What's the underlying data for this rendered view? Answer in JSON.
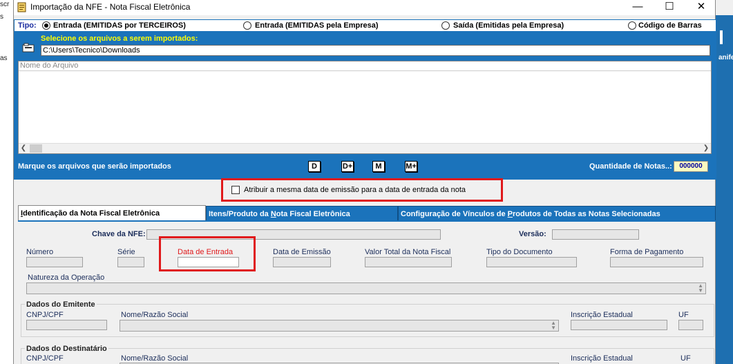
{
  "background": {
    "left_fragments": [
      "scr",
      "s",
      "as"
    ],
    "right_fragment": "anife"
  },
  "window": {
    "title": "Importação da NFE - Nota Fiscal Eletrônica",
    "minimize": "—",
    "maximize": "☐",
    "close": "✕"
  },
  "tipo": {
    "label": "Tipo:",
    "options": [
      {
        "label": "Entrada (EMITIDAS por TERCEIROS)",
        "selected": true
      },
      {
        "label": "Entrada (EMITIDAS pela Empresa)",
        "selected": false
      },
      {
        "label": "Saída (Emitidas pela Empresa)",
        "selected": false
      },
      {
        "label": "Código de Barras",
        "selected": false
      }
    ]
  },
  "files": {
    "select_label": "Selecione os arquivos a serem importados:",
    "path": "C:\\Users\\Tecnico\\Downloads",
    "column_header": "Nome do Arquivo",
    "rows": []
  },
  "marks": {
    "label": "Marque os arquivos que serão importados",
    "buttons": [
      "D",
      "D+",
      "M",
      "M+"
    ],
    "quantity_label": "Quantidade de Notas..:",
    "quantity_value": "000000"
  },
  "same_date": {
    "label": "Atribuir a mesma data de emissão para a data de entrada da nota",
    "checked": false
  },
  "tabs": [
    {
      "pre": "",
      "ul": "I",
      "post": "dentificação da Nota Fiscal Eletrônica",
      "active": true
    },
    {
      "pre": "Itens/Produto da ",
      "ul": "N",
      "post": "ota Fiscal Eletrônica",
      "active": false
    },
    {
      "pre": "Configuração de Vínculos de ",
      "ul": "P",
      "post": "rodutos de Todas as Notas Selecionadas",
      "active": false
    }
  ],
  "form": {
    "chave_label": "Chave da NFE:",
    "versao_label": "Versão:",
    "numero_label": "Número",
    "serie_label": "Série",
    "data_entrada_label": "Data de Entrada",
    "data_emissao_label": "Data de Emissão",
    "valor_total_label": "Valor Total da Nota Fiscal",
    "tipo_documento_label": "Tipo do Documento",
    "forma_pagamento_label": "Forma de Pagamento",
    "natureza_label": "Natureza da Operação"
  },
  "emitente": {
    "title": "Dados do Emitente",
    "cnpj_label": "CNPJ/CPF",
    "nome_label": "Nome/Razão Social",
    "ie_label": "Inscrição Estadual",
    "uf_label": "UF"
  },
  "destinatario": {
    "title": "Dados do Destinatário",
    "cnpj_label": "CNPJ/CPF",
    "nome_label": "Nome/Razão Social",
    "ie_label": "Inscrição Estadual",
    "uf_label": "UF"
  },
  "colors": {
    "accent_blue": "#1b73bb",
    "highlight_red": "#e0191b",
    "label_yellow": "#ffff00"
  }
}
